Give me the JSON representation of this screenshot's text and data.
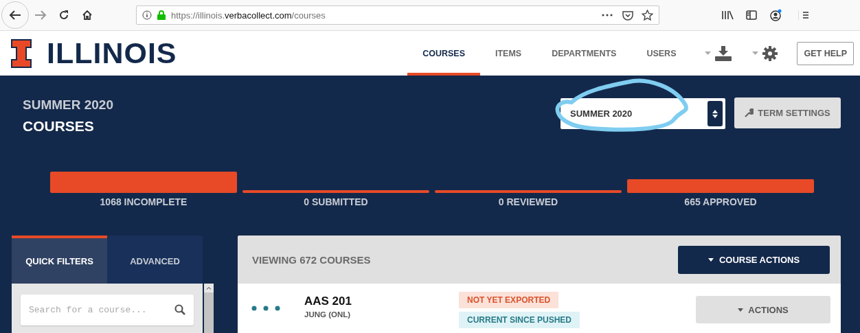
{
  "browser": {
    "url_scheme_host": "https://illinois.",
    "url_domain": "verbacollect.com",
    "url_path": "/courses"
  },
  "header": {
    "logo": "ILLINOIS",
    "nav": [
      {
        "label": "COURSES",
        "selected": true
      },
      {
        "label": "ITEMS",
        "selected": false
      },
      {
        "label": "DEPARTMENTS",
        "selected": false
      },
      {
        "label": "USERS",
        "selected": false
      }
    ],
    "help_button": "GET HELP"
  },
  "term": {
    "label": "SUMMER 2020",
    "title": "COURSES",
    "select_value": "SUMMER 2020",
    "settings_button": "TERM SETTINGS"
  },
  "statuses": [
    {
      "label": "1068 INCOMPLETE",
      "kind": "large"
    },
    {
      "label": "0 SUBMITTED",
      "kind": "empty"
    },
    {
      "label": "0 REVIEWED",
      "kind": "empty"
    },
    {
      "label": "665 APPROVED",
      "kind": "medium"
    }
  ],
  "filters": {
    "tabs": [
      {
        "label": "QUICK FILTERS",
        "selected": true
      },
      {
        "label": "ADVANCED",
        "selected": false
      }
    ],
    "search": {
      "placeholder": "Search for a course..."
    }
  },
  "courses": {
    "heading": "VIEWING 672 COURSES",
    "actions_button": "COURSE ACTIONS",
    "rows": [
      {
        "code": "AAS 201",
        "instructor": "JUNG (ONL)",
        "tags": [
          {
            "label": "NOT YET EXPORTED",
            "kind": "warning"
          },
          {
            "label": "CURRENT SINCE PUSHED",
            "kind": "info"
          }
        ],
        "actions_button": "ACTIONS"
      }
    ]
  }
}
